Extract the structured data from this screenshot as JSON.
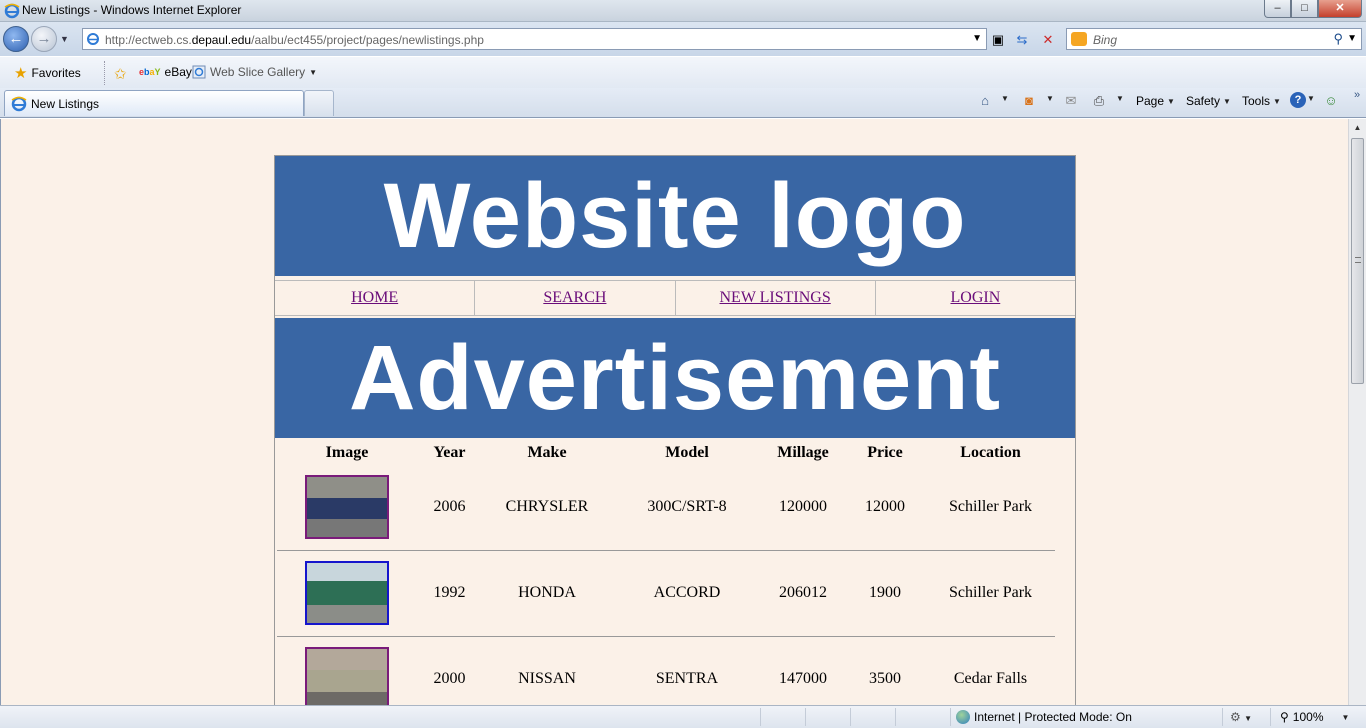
{
  "window": {
    "title": "New Listings - Windows Internet Explorer",
    "controls": {
      "minimize": "–",
      "maximize": "□",
      "close": "✕"
    }
  },
  "addressbar": {
    "url_prefix": "http://ectweb.cs.",
    "url_domain": "depaul.edu",
    "url_path": "/aalbu/ect455/project/pages/newlistings.php",
    "search_placeholder": "Bing"
  },
  "favorites": {
    "favorites_label": "Favorites",
    "items": [
      {
        "label": "eBay"
      },
      {
        "label": "Web Slice Gallery"
      }
    ]
  },
  "tabs": [
    {
      "label": "New Listings"
    }
  ],
  "commandbar": {
    "page": "Page",
    "safety": "Safety",
    "tools": "Tools"
  },
  "site": {
    "logo_text": "Website logo",
    "nav": [
      "HOME",
      "SEARCH",
      "NEW LISTINGS",
      "LOGIN"
    ],
    "ad_text": "Advertisement",
    "table": {
      "headers": [
        "Image",
        "Year",
        "Make",
        "Model",
        "Millage",
        "Price",
        "Location"
      ],
      "rows": [
        {
          "year": "2006",
          "make": "CHRYSLER",
          "model": "300C/SRT-8",
          "millage": "120000",
          "price": "12000",
          "location": "Schiller Park"
        },
        {
          "year": "1992",
          "make": "HONDA",
          "model": "ACCORD",
          "millage": "206012",
          "price": "1900",
          "location": "Schiller Park"
        },
        {
          "year": "2000",
          "make": "NISSAN",
          "model": "SENTRA",
          "millage": "147000",
          "price": "3500",
          "location": "Cedar Falls"
        }
      ]
    }
  },
  "status": {
    "zone": "Internet | Protected Mode: On",
    "zoom": "100%"
  },
  "colors": {
    "banner": "#3966a4",
    "page_bg": "#fbf1e8",
    "link": "#6a0d7a"
  }
}
